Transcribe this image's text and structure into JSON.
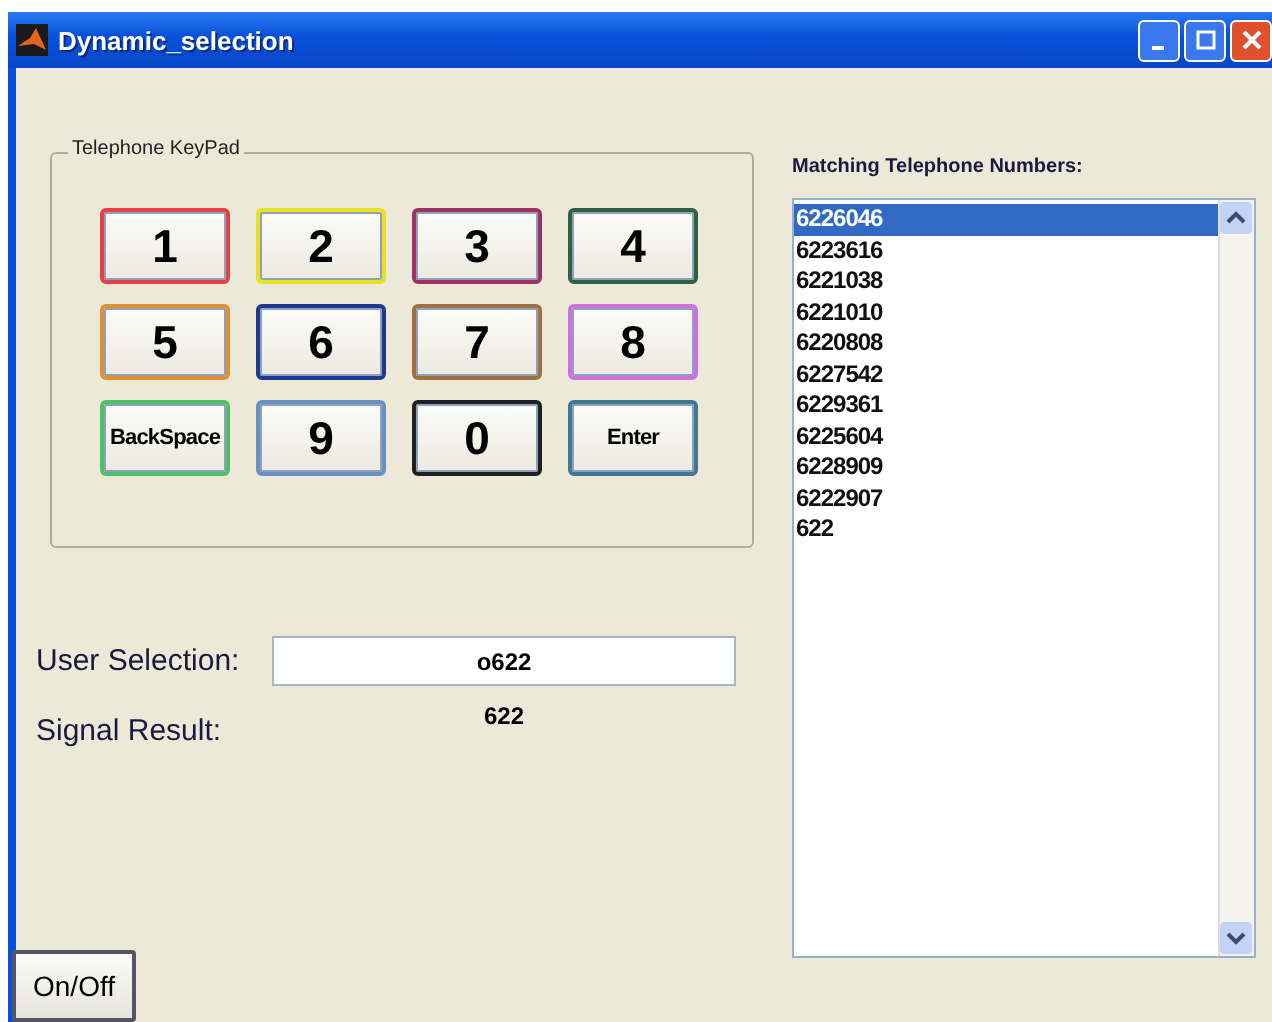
{
  "window": {
    "title": "Dynamic_selection"
  },
  "keypad": {
    "title": "Telephone KeyPad",
    "keys": [
      {
        "label": "1",
        "kind": "digit",
        "color": "#e84040"
      },
      {
        "label": "2",
        "kind": "digit",
        "color": "#e8e020"
      },
      {
        "label": "3",
        "kind": "digit",
        "color": "#a03060"
      },
      {
        "label": "4",
        "kind": "digit",
        "color": "#306040"
      },
      {
        "label": "5",
        "kind": "digit",
        "color": "#e09030"
      },
      {
        "label": "6",
        "kind": "digit",
        "color": "#203890"
      },
      {
        "label": "7",
        "kind": "digit",
        "color": "#a07040"
      },
      {
        "label": "8",
        "kind": "digit",
        "color": "#d070e0"
      },
      {
        "label": "BackSpace",
        "kind": "command",
        "color": "#50c060"
      },
      {
        "label": "9",
        "kind": "digit",
        "color": "#6890c0"
      },
      {
        "label": "0",
        "kind": "digit",
        "color": "#202020"
      },
      {
        "label": "Enter",
        "kind": "command",
        "color": "#407890"
      }
    ]
  },
  "user_selection": {
    "label": "User Selection:",
    "value": "o622"
  },
  "signal_result": {
    "label": "Signal Result:",
    "value": "622"
  },
  "matching": {
    "title": "Matching Telephone Numbers:",
    "items": [
      {
        "text": "6226046",
        "selected": true
      },
      {
        "text": "6223616",
        "selected": false
      },
      {
        "text": "6221038",
        "selected": false
      },
      {
        "text": "6221010",
        "selected": false
      },
      {
        "text": "6220808",
        "selected": false
      },
      {
        "text": "6227542",
        "selected": false
      },
      {
        "text": "6229361",
        "selected": false
      },
      {
        "text": "6225604",
        "selected": false
      },
      {
        "text": "6228909",
        "selected": false
      },
      {
        "text": "6222907",
        "selected": false
      },
      {
        "text": "622",
        "selected": false
      }
    ]
  },
  "power_button": {
    "label": "On/Off"
  }
}
